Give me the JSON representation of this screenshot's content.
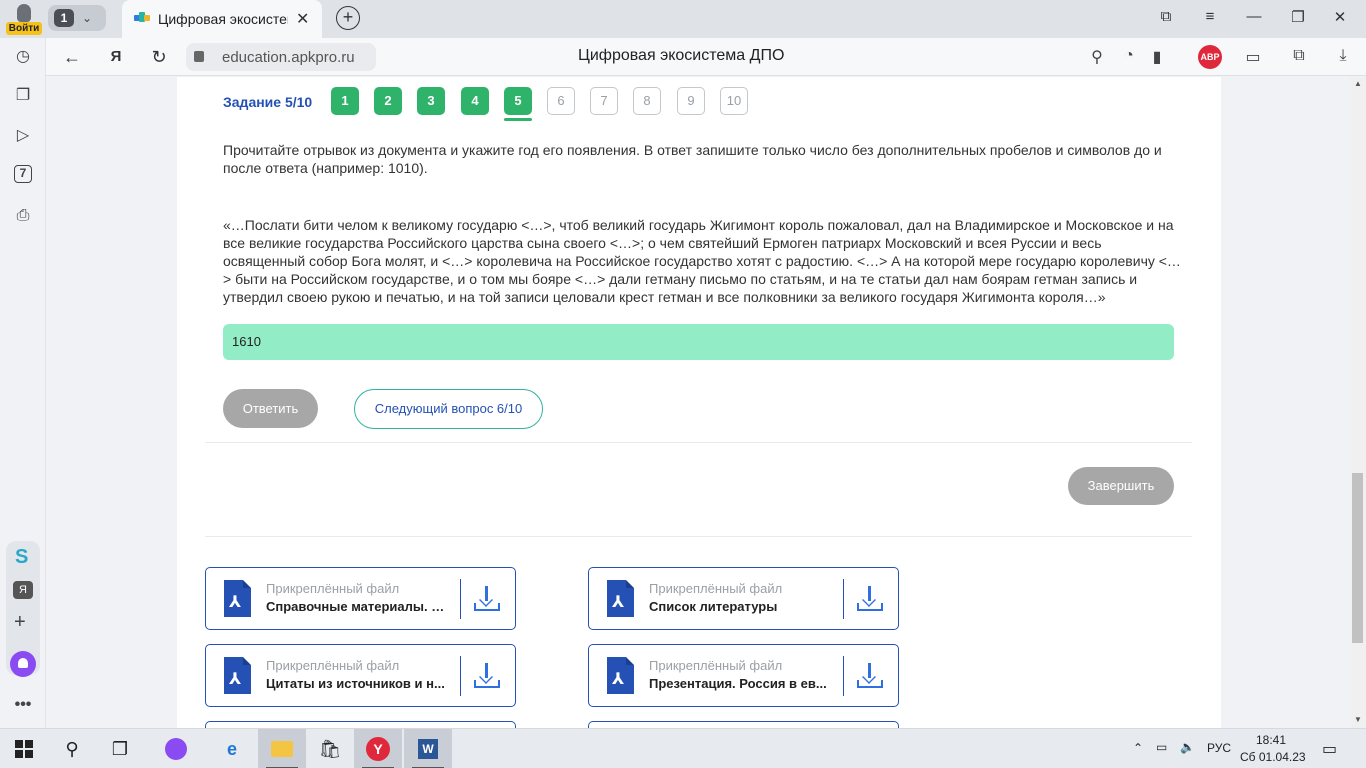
{
  "browser": {
    "login_label": "Войти",
    "tab_count": "1",
    "tab_title": "Цифровая экосистема ДПО",
    "url_host": "education.apkpro.ru",
    "page_title": "Цифровая экосистема ДПО",
    "abp_label": "ABP",
    "sidebar_badge": "7"
  },
  "quiz": {
    "task_label": "Задание 5/10",
    "questions": [
      {
        "label": "1",
        "state": "done"
      },
      {
        "label": "2",
        "state": "done"
      },
      {
        "label": "3",
        "state": "done"
      },
      {
        "label": "4",
        "state": "done"
      },
      {
        "label": "5",
        "state": "done"
      },
      {
        "label": "6",
        "state": "todo"
      },
      {
        "label": "7",
        "state": "todo"
      },
      {
        "label": "8",
        "state": "todo"
      },
      {
        "label": "9",
        "state": "todo"
      },
      {
        "label": "10",
        "state": "todo"
      }
    ],
    "current": 5,
    "prompt": "Прочитайте отрывок из документа и укажите год его появления. В ответ запишите только число без дополнительных пробелов и символов до и после ответа (например: 1010).",
    "quote": "«…Послати бити челом к великому государю <…>, чтоб великий государь Жигимонт король пожаловал, дал на Владимирское и Московское и на все великие государства Российского царства сына своего <…>; о чем святейший Ермоген патриарх Московский и всея Руссии и весь освященный собор Бога молят, и <…> королевича на Российское государство хотят с радостию. <…> А на которой мере государю королевичу <…> быти на Российском государстве, и о том мы бояре <…> дали гетману письмо по статьям, и на те статьи дал нам боярам гетман запись и утвердил своею рукою и печатью, и на той записи целовали крест гетман и все полковники за великого государя Жигимонта короля…»",
    "answer_value": "1610",
    "reply_button": "Ответить",
    "next_button": "Следующий вопрос 6/10",
    "finish_button": "Завершить"
  },
  "files": [
    {
      "type_label": "Прикреплённый файл",
      "name": "Справочные материалы. Р..."
    },
    {
      "type_label": "Прикреплённый файл",
      "name": "Список литературы"
    },
    {
      "type_label": "Прикреплённый файл",
      "name": "Цитаты из источников и н..."
    },
    {
      "type_label": "Прикреплённый файл",
      "name": "Презентация. Россия в ев..."
    }
  ],
  "taskbar": {
    "lang": "РУС",
    "time": "18:41",
    "date": "Сб 01.04.23",
    "word_label": "W"
  },
  "colors": {
    "accent_blue": "#2451b3",
    "done_green": "#2fb36a",
    "answer_green": "#92ecc5",
    "button_gray": "#a7a7a7"
  }
}
